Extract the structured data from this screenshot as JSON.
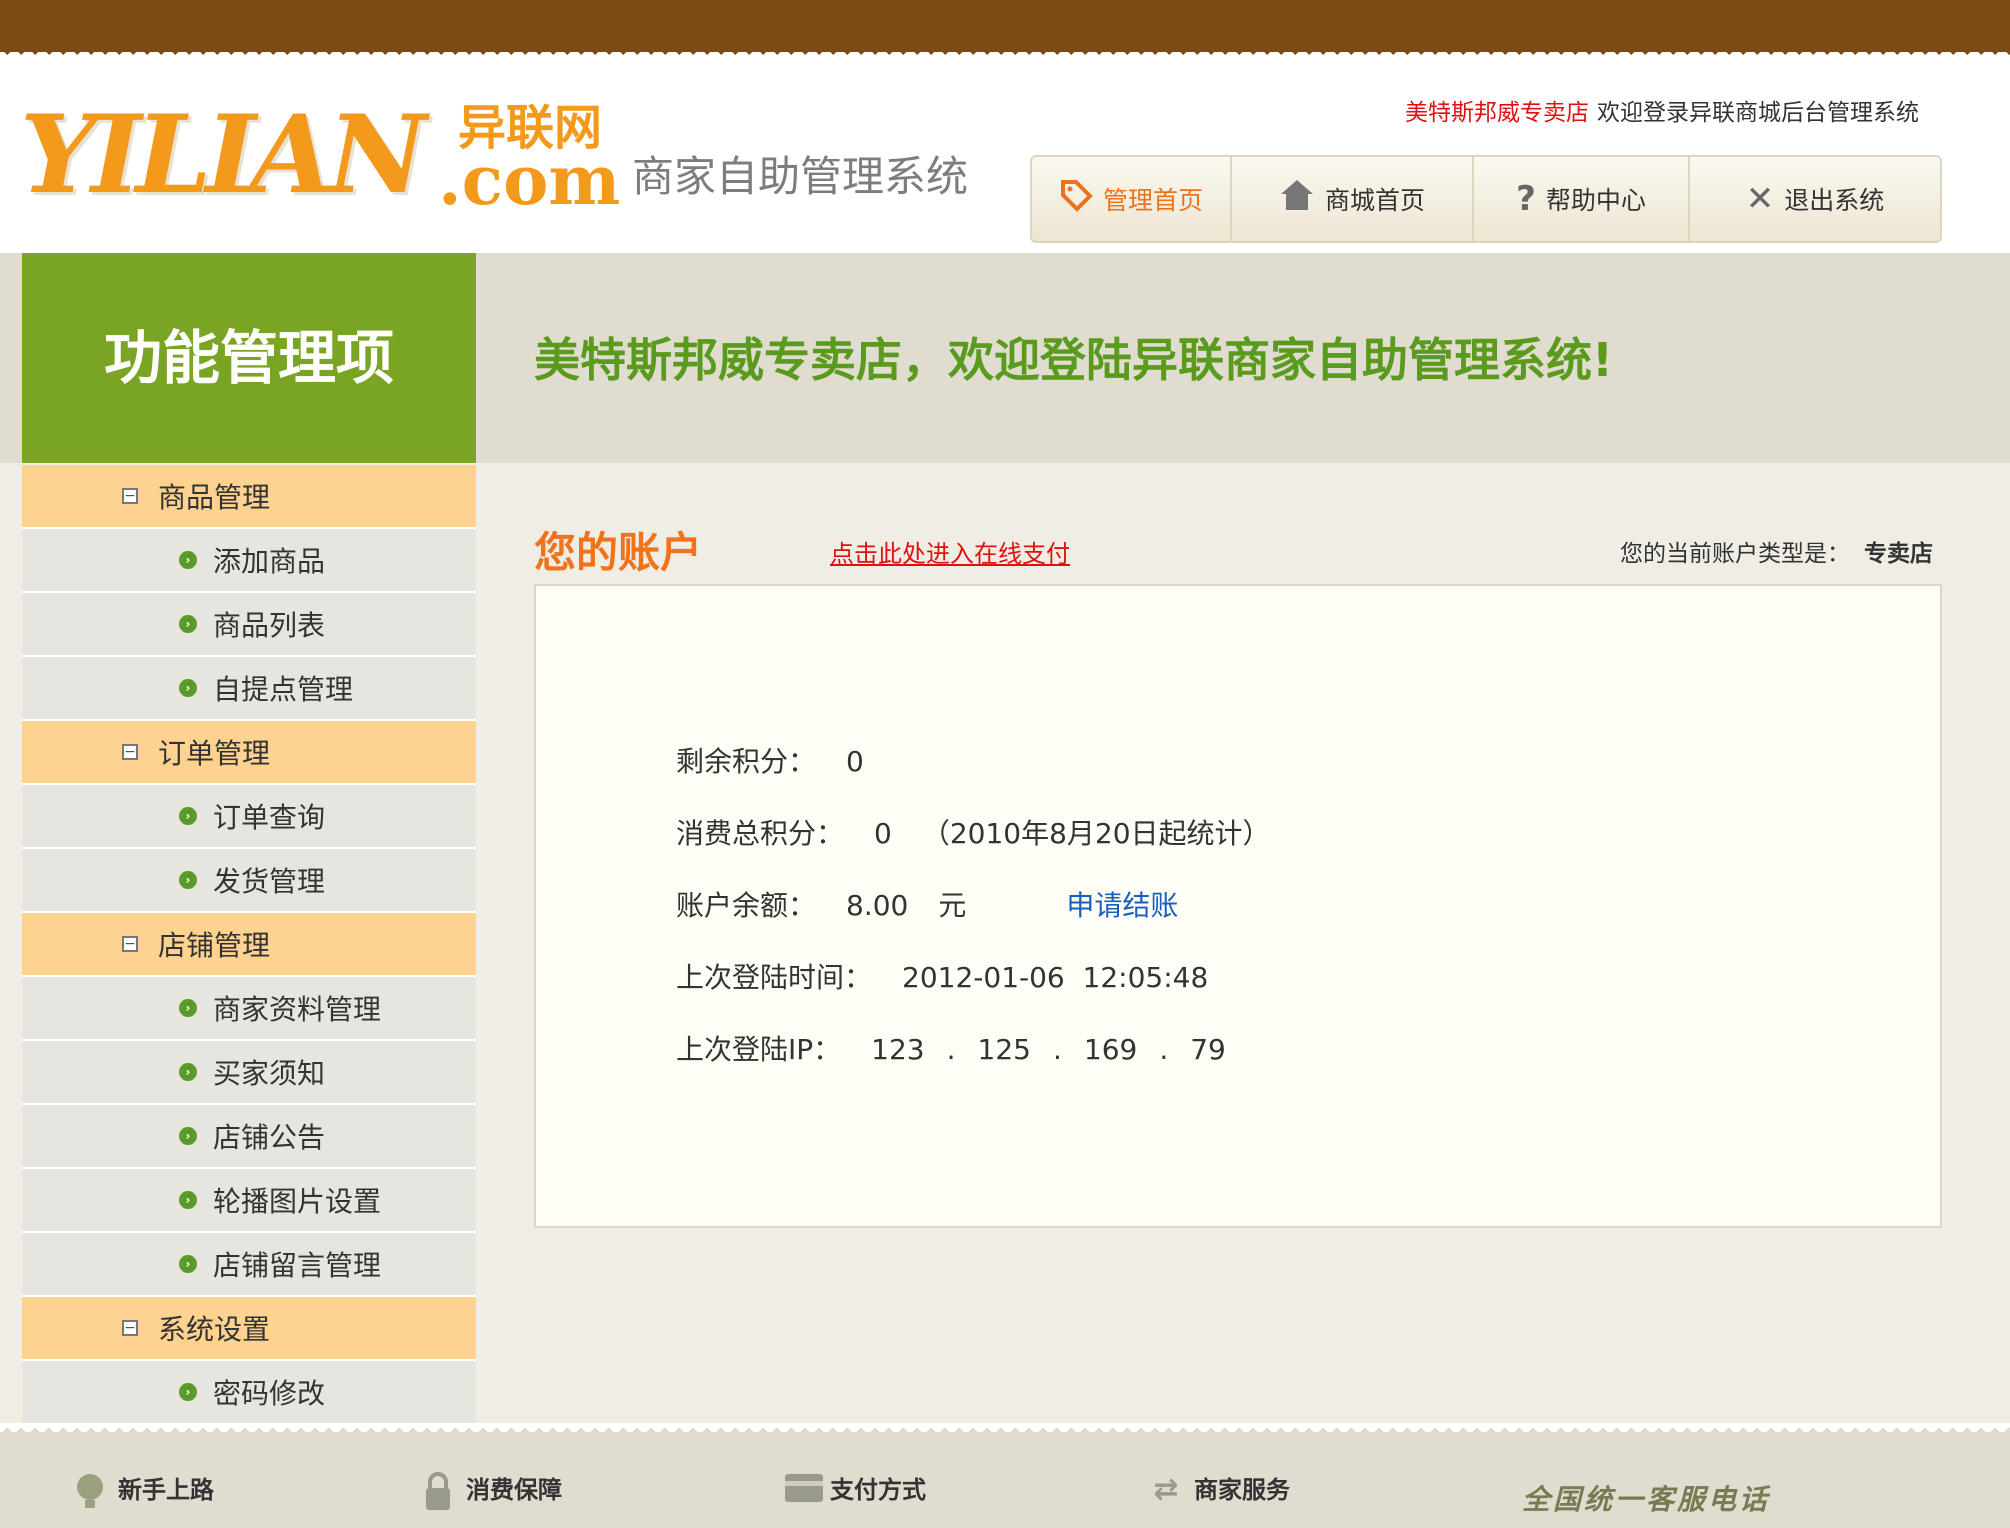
{
  "header": {
    "logo_text": "YILIAN",
    "logo_cn": "异联网",
    "logo_com": ".com",
    "system_name": "商家自助管理系统",
    "shop_name": "美特斯邦威专卖店",
    "welcome_msg": "欢迎登录异联商城后台管理系统"
  },
  "nav": [
    {
      "label": "管理首页",
      "icon": "tag-icon",
      "active": true
    },
    {
      "label": "商城首页",
      "icon": "home-icon",
      "active": false
    },
    {
      "label": "帮助中心",
      "icon": "question-icon",
      "active": false
    },
    {
      "label": "退出系统",
      "icon": "close-icon",
      "active": false
    }
  ],
  "sidebar": {
    "title": "功能管理项",
    "groups": [
      {
        "label": "商品管理",
        "items": [
          "添加商品",
          "商品列表",
          "自提点管理"
        ]
      },
      {
        "label": "订单管理",
        "items": [
          "订单查询",
          "发货管理"
        ]
      },
      {
        "label": "店铺管理",
        "items": [
          "商家资料管理",
          "买家须知",
          "店铺公告",
          "轮播图片设置",
          "店铺留言管理"
        ]
      },
      {
        "label": "系统设置",
        "items": [
          "密码修改"
        ]
      }
    ]
  },
  "banner": {
    "text": "美特斯邦威专卖店，欢迎登陆异联商家自助管理系统!"
  },
  "account": {
    "title": "您的账户",
    "pay_link": "点击此处进入在线支付",
    "type_label": "您的当前账户类型是：",
    "type_value": "专卖店",
    "remaining_points_label": "剩余积分：",
    "remaining_points": "0",
    "total_points_label": "消费总积分：",
    "total_points": "0",
    "total_points_note": "（2010年8月20日起统计）",
    "balance_label": "账户余额：",
    "balance": "8.00",
    "balance_unit": "元",
    "apply_settle": "申请结账",
    "last_login_time_label": "上次登陆时间：",
    "last_login_time": "2012-01-06  12:05:48",
    "last_login_ip_label": "上次登陆IP：",
    "ip": [
      "123",
      "125",
      "169",
      "79"
    ]
  },
  "footer": {
    "items": [
      {
        "label": "新手上路",
        "icon": "bulb-icon"
      },
      {
        "label": "消费保障",
        "icon": "lock-icon"
      },
      {
        "label": "支付方式",
        "icon": "card-icon"
      },
      {
        "label": "商家服务",
        "icon": "exchange-icon"
      }
    ],
    "hotline": "全国统一客服电话"
  },
  "colors": {
    "brand_orange": "#f39a1c",
    "sidebar_green": "#7aa424",
    "group_bg": "#fed28f",
    "top_band": "#7c4a14"
  }
}
